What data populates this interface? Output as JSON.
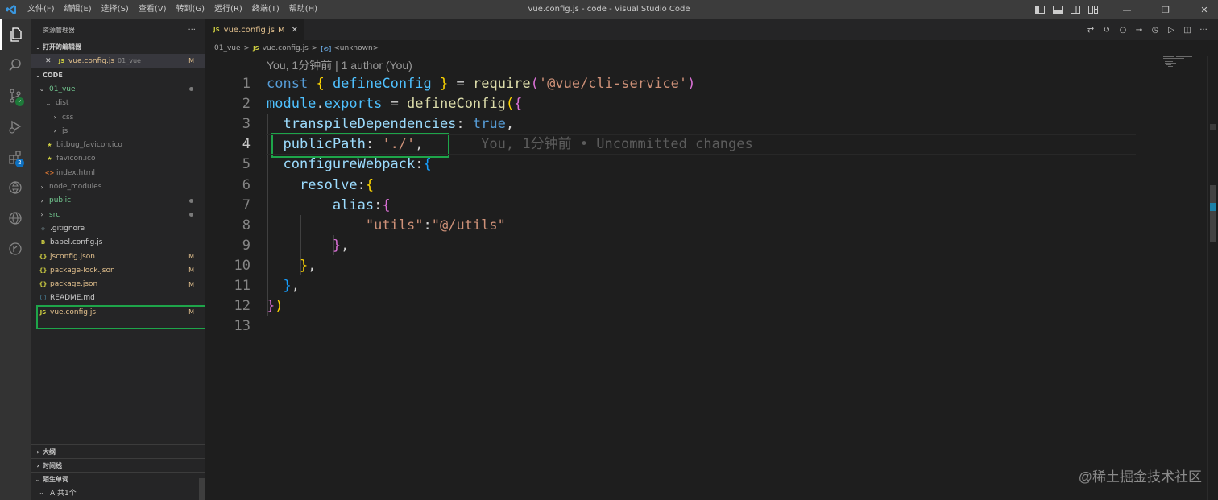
{
  "window": {
    "title": "vue.config.js - code - Visual Studio Code",
    "menu": [
      "文件(F)",
      "编辑(E)",
      "选择(S)",
      "查看(V)",
      "转到(G)",
      "运行(R)",
      "终端(T)",
      "帮助(H)"
    ],
    "controls": {
      "minimize": "—",
      "restore": "❐",
      "close": "✕"
    }
  },
  "activity_bar": {
    "items": [
      "explorer-icon",
      "search-icon",
      "source-control-icon",
      "run-debug-icon",
      "extensions-icon",
      "openai-icon",
      "remote-icon",
      "git-history-icon"
    ],
    "extensions_badge": "2"
  },
  "sidebar": {
    "title": "资源管理器",
    "more": "···",
    "open_editors": {
      "header": "打开的编辑器",
      "items": [
        {
          "close": "✕",
          "icon": "JS",
          "name": "vue.config.js",
          "desc": "01_vue",
          "status": "M"
        }
      ]
    },
    "workspace": {
      "header": "CODE",
      "tree": [
        {
          "label": "01_vue",
          "chev": "⌄",
          "icon": "",
          "icon_color": "",
          "color": "#73c991",
          "status": "",
          "dot": true,
          "indent": 0
        },
        {
          "label": "dist",
          "chev": "⌄",
          "icon": "",
          "icon_color": "",
          "color": "#8c8c8c",
          "status": "",
          "dot": false,
          "indent": 1
        },
        {
          "label": "css",
          "chev": "›",
          "icon": "",
          "icon_color": "",
          "color": "#8c8c8c",
          "status": "",
          "dot": false,
          "indent": 2
        },
        {
          "label": "js",
          "chev": "›",
          "icon": "",
          "icon_color": "",
          "color": "#8c8c8c",
          "status": "",
          "dot": false,
          "indent": 2
        },
        {
          "label": "bitbug_favicon.ico",
          "chev": "",
          "icon": "★",
          "icon_color": "#cbcb41",
          "color": "#8c8c8c",
          "status": "",
          "dot": false,
          "indent": 1
        },
        {
          "label": "favicon.ico",
          "chev": "",
          "icon": "★",
          "icon_color": "#cbcb41",
          "color": "#8c8c8c",
          "status": "",
          "dot": false,
          "indent": 1
        },
        {
          "label": "index.html",
          "chev": "",
          "icon": "<>",
          "icon_color": "#e37933",
          "color": "#8c8c8c",
          "status": "",
          "dot": false,
          "indent": 1
        },
        {
          "label": "node_modules",
          "chev": "›",
          "icon": "",
          "icon_color": "",
          "color": "#8c8c8c",
          "status": "",
          "dot": false,
          "indent": 0
        },
        {
          "label": "public",
          "chev": "›",
          "icon": "",
          "icon_color": "",
          "color": "#73c991",
          "status": "",
          "dot": true,
          "indent": 0
        },
        {
          "label": "src",
          "chev": "›",
          "icon": "",
          "icon_color": "",
          "color": "#73c991",
          "status": "",
          "dot": true,
          "indent": 0
        },
        {
          "label": ".gitignore",
          "chev": "",
          "icon": "◈",
          "icon_color": "#6d8086",
          "color": "#cccccc",
          "status": "",
          "dot": false,
          "indent": 0
        },
        {
          "label": "babel.config.js",
          "chev": "",
          "icon": "B",
          "icon_color": "#cbcb41",
          "color": "#cccccc",
          "status": "",
          "dot": false,
          "indent": 0
        },
        {
          "label": "jsconfig.json",
          "chev": "",
          "icon": "{}",
          "icon_color": "#cbcb41",
          "color": "#e2c08d",
          "status": "M",
          "dot": false,
          "indent": 0
        },
        {
          "label": "package-lock.json",
          "chev": "",
          "icon": "{}",
          "icon_color": "#cbcb41",
          "color": "#e2c08d",
          "status": "M",
          "dot": false,
          "indent": 0
        },
        {
          "label": "package.json",
          "chev": "",
          "icon": "{}",
          "icon_color": "#cbcb41",
          "color": "#e2c08d",
          "status": "M",
          "dot": false,
          "indent": 0
        },
        {
          "label": "README.md",
          "chev": "",
          "icon": "ⓘ",
          "icon_color": "#519aba",
          "color": "#cccccc",
          "status": "",
          "dot": false,
          "indent": 0
        },
        {
          "label": "vue.config.js",
          "chev": "",
          "icon": "JS",
          "icon_color": "#cbcb41",
          "color": "#e2c08d",
          "status": "M",
          "dot": false,
          "indent": 0
        }
      ]
    },
    "bottom_sections": [
      {
        "chev": "›",
        "label": "大纲"
      },
      {
        "chev": "›",
        "label": "时间线"
      },
      {
        "chev": "⌄",
        "label": "陌生单词"
      }
    ],
    "word_row": "A 共1个"
  },
  "editor": {
    "tab": {
      "icon": "JS",
      "name": "vue.config.js",
      "status": "M",
      "close": "✕"
    },
    "breadcrumb": {
      "folder": "01_vue",
      "file": "vue.config.js",
      "symbol": "<unknown>",
      "sep": ">"
    },
    "codelens": "You, 1分钟前 | 1 author (You)",
    "line_numbers": [
      "1",
      "2",
      "3",
      "4",
      "5",
      "6",
      "7",
      "8",
      "9",
      "10",
      "11",
      "12",
      "13"
    ],
    "current_line": "4",
    "lines": [
      [
        [
          "k",
          "const"
        ],
        [
          "t",
          " "
        ],
        [
          "b1",
          "{"
        ],
        [
          "t",
          " "
        ],
        [
          "v",
          "defineConfig"
        ],
        [
          "t",
          " "
        ],
        [
          "b1",
          "}"
        ],
        [
          "t",
          " = "
        ],
        [
          "f",
          "require"
        ],
        [
          "b2",
          "("
        ],
        [
          "s",
          "'@vue/cli-service'"
        ],
        [
          "b2",
          ")"
        ]
      ],
      [
        [
          "v",
          "module"
        ],
        [
          "t",
          "."
        ],
        [
          "v",
          "exports"
        ],
        [
          "t",
          " = "
        ],
        [
          "f",
          "defineConfig"
        ],
        [
          "b1",
          "("
        ],
        [
          "b2",
          "{"
        ]
      ],
      [
        [
          "t",
          "  "
        ],
        [
          "p",
          "transpileDependencies"
        ],
        [
          "t",
          ": "
        ],
        [
          "k",
          "true"
        ],
        [
          "t",
          ","
        ]
      ],
      [
        [
          "t",
          "  "
        ],
        [
          "p",
          "publicPath"
        ],
        [
          "t",
          ": "
        ],
        [
          "s",
          "'./'"
        ],
        [
          "t",
          ","
        ],
        [
          "blame",
          "       You, 1分钟前 • Uncommitted changes"
        ]
      ],
      [
        [
          "t",
          "  "
        ],
        [
          "p",
          "configureWebpack"
        ],
        [
          "t",
          ":"
        ],
        [
          "b3",
          "{"
        ]
      ],
      [
        [
          "t",
          "    "
        ],
        [
          "p",
          "resolve"
        ],
        [
          "t",
          ":"
        ],
        [
          "b1",
          "{"
        ]
      ],
      [
        [
          "t",
          "        "
        ],
        [
          "p",
          "alias"
        ],
        [
          "t",
          ":"
        ],
        [
          "b2",
          "{"
        ]
      ],
      [
        [
          "t",
          "            "
        ],
        [
          "s",
          "\"utils\""
        ],
        [
          "t",
          ":"
        ],
        [
          "s",
          "\"@/utils\""
        ]
      ],
      [
        [
          "t",
          "        "
        ],
        [
          "b2",
          "}"
        ],
        [
          "t",
          ","
        ]
      ],
      [
        [
          "t",
          "    "
        ],
        [
          "b1",
          "}"
        ],
        [
          "t",
          ","
        ]
      ],
      [
        [
          "t",
          "  "
        ],
        [
          "b3",
          "}"
        ],
        [
          "t",
          ","
        ]
      ],
      [
        [
          "b2",
          "}"
        ],
        [
          "b1",
          ")"
        ]
      ],
      []
    ]
  },
  "watermark": "@稀土掘金技术社区"
}
